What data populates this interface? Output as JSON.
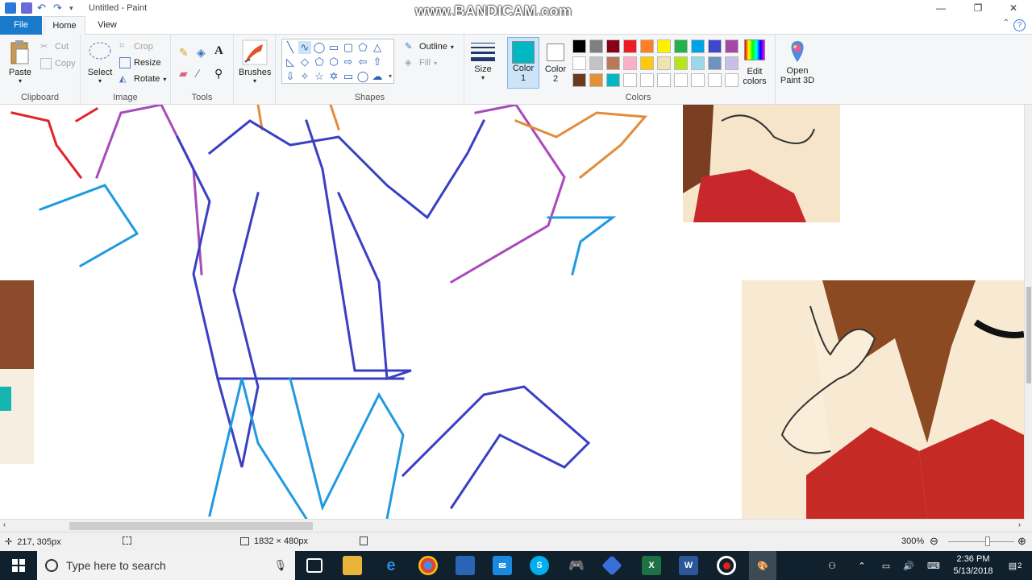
{
  "window": {
    "title": "Untitled - Paint",
    "watermark": "www.BANDICAM.com",
    "minimize_glyph": "—",
    "maximize_glyph": "❐",
    "close_glyph": "✕"
  },
  "tabs": {
    "file": "File",
    "home": "Home",
    "view": "View",
    "help_glyph": "?"
  },
  "ribbon": {
    "clipboard": {
      "label": "Clipboard",
      "paste": "Paste",
      "cut": "Cut",
      "copy": "Copy"
    },
    "image": {
      "label": "Image",
      "select": "Select",
      "crop": "Crop",
      "resize": "Resize",
      "rotate": "Rotate"
    },
    "tools": {
      "label": "Tools"
    },
    "brushes": {
      "label": "Brushes"
    },
    "shapes": {
      "label": "Shapes",
      "outline": "Outline",
      "fill": "Fill"
    },
    "size": {
      "label": "Size"
    },
    "colors": {
      "label": "Colors",
      "color1_label": "Color",
      "color1_num": "1",
      "color2_label": "Color",
      "color2_num": "2",
      "edit_label": "Edit",
      "edit_label2": "colors",
      "color1": "#00b7c3",
      "color2": "#ffffff",
      "palette_row1": [
        "#000000",
        "#7f7f7f",
        "#880015",
        "#ed1c24",
        "#ff7f27",
        "#fff200",
        "#22b14c",
        "#00a2e8",
        "#3f48cc",
        "#a349a4"
      ],
      "palette_row2": [
        "#ffffff",
        "#c3c3c3",
        "#b97a57",
        "#ffaec9",
        "#ffc90e",
        "#efe4b0",
        "#b5e61d",
        "#99d9ea",
        "#7092be",
        "#c8bfe7"
      ],
      "palette_row3": [
        "#6b3a1e",
        "#e0913a",
        "#00b7c3",
        "#ffffff",
        "#ffffff",
        "#ffffff",
        "#ffffff",
        "#ffffff",
        "#ffffff",
        "#ffffff"
      ]
    },
    "paint3d": {
      "label1": "Open",
      "label2": "Paint 3D"
    }
  },
  "status": {
    "cursor_pos": "217, 305px",
    "dimensions": "1832 × 480px",
    "zoom": "300%"
  },
  "taskbar": {
    "search_placeholder": "Type here to search",
    "time": "2:36 PM",
    "date": "5/13/2018",
    "notifications_count": "2"
  }
}
